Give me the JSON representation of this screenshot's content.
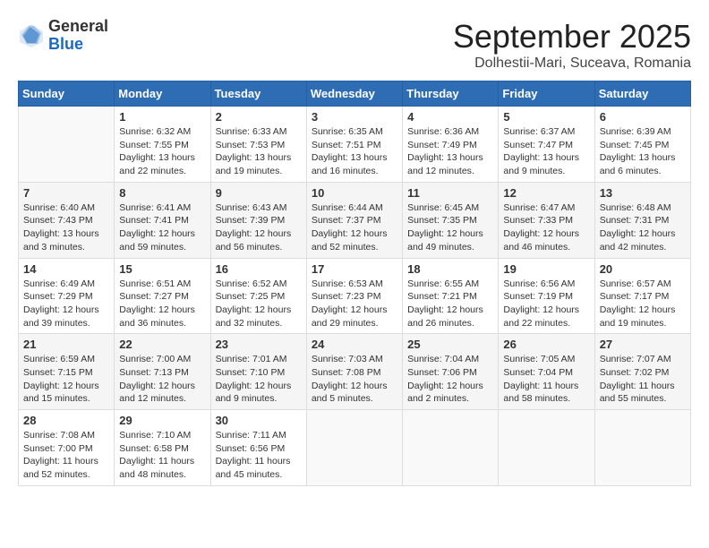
{
  "logo": {
    "general": "General",
    "blue": "Blue"
  },
  "title": "September 2025",
  "location": "Dolhestii-Mari, Suceava, Romania",
  "headers": [
    "Sunday",
    "Monday",
    "Tuesday",
    "Wednesday",
    "Thursday",
    "Friday",
    "Saturday"
  ],
  "weeks": [
    [
      {
        "day": "",
        "content": ""
      },
      {
        "day": "1",
        "content": "Sunrise: 6:32 AM\nSunset: 7:55 PM\nDaylight: 13 hours and 22 minutes."
      },
      {
        "day": "2",
        "content": "Sunrise: 6:33 AM\nSunset: 7:53 PM\nDaylight: 13 hours and 19 minutes."
      },
      {
        "day": "3",
        "content": "Sunrise: 6:35 AM\nSunset: 7:51 PM\nDaylight: 13 hours and 16 minutes."
      },
      {
        "day": "4",
        "content": "Sunrise: 6:36 AM\nSunset: 7:49 PM\nDaylight: 13 hours and 12 minutes."
      },
      {
        "day": "5",
        "content": "Sunrise: 6:37 AM\nSunset: 7:47 PM\nDaylight: 13 hours and 9 minutes."
      },
      {
        "day": "6",
        "content": "Sunrise: 6:39 AM\nSunset: 7:45 PM\nDaylight: 13 hours and 6 minutes."
      }
    ],
    [
      {
        "day": "7",
        "content": "Sunrise: 6:40 AM\nSunset: 7:43 PM\nDaylight: 13 hours and 3 minutes."
      },
      {
        "day": "8",
        "content": "Sunrise: 6:41 AM\nSunset: 7:41 PM\nDaylight: 12 hours and 59 minutes."
      },
      {
        "day": "9",
        "content": "Sunrise: 6:43 AM\nSunset: 7:39 PM\nDaylight: 12 hours and 56 minutes."
      },
      {
        "day": "10",
        "content": "Sunrise: 6:44 AM\nSunset: 7:37 PM\nDaylight: 12 hours and 52 minutes."
      },
      {
        "day": "11",
        "content": "Sunrise: 6:45 AM\nSunset: 7:35 PM\nDaylight: 12 hours and 49 minutes."
      },
      {
        "day": "12",
        "content": "Sunrise: 6:47 AM\nSunset: 7:33 PM\nDaylight: 12 hours and 46 minutes."
      },
      {
        "day": "13",
        "content": "Sunrise: 6:48 AM\nSunset: 7:31 PM\nDaylight: 12 hours and 42 minutes."
      }
    ],
    [
      {
        "day": "14",
        "content": "Sunrise: 6:49 AM\nSunset: 7:29 PM\nDaylight: 12 hours and 39 minutes."
      },
      {
        "day": "15",
        "content": "Sunrise: 6:51 AM\nSunset: 7:27 PM\nDaylight: 12 hours and 36 minutes."
      },
      {
        "day": "16",
        "content": "Sunrise: 6:52 AM\nSunset: 7:25 PM\nDaylight: 12 hours and 32 minutes."
      },
      {
        "day": "17",
        "content": "Sunrise: 6:53 AM\nSunset: 7:23 PM\nDaylight: 12 hours and 29 minutes."
      },
      {
        "day": "18",
        "content": "Sunrise: 6:55 AM\nSunset: 7:21 PM\nDaylight: 12 hours and 26 minutes."
      },
      {
        "day": "19",
        "content": "Sunrise: 6:56 AM\nSunset: 7:19 PM\nDaylight: 12 hours and 22 minutes."
      },
      {
        "day": "20",
        "content": "Sunrise: 6:57 AM\nSunset: 7:17 PM\nDaylight: 12 hours and 19 minutes."
      }
    ],
    [
      {
        "day": "21",
        "content": "Sunrise: 6:59 AM\nSunset: 7:15 PM\nDaylight: 12 hours and 15 minutes."
      },
      {
        "day": "22",
        "content": "Sunrise: 7:00 AM\nSunset: 7:13 PM\nDaylight: 12 hours and 12 minutes."
      },
      {
        "day": "23",
        "content": "Sunrise: 7:01 AM\nSunset: 7:10 PM\nDaylight: 12 hours and 9 minutes."
      },
      {
        "day": "24",
        "content": "Sunrise: 7:03 AM\nSunset: 7:08 PM\nDaylight: 12 hours and 5 minutes."
      },
      {
        "day": "25",
        "content": "Sunrise: 7:04 AM\nSunset: 7:06 PM\nDaylight: 12 hours and 2 minutes."
      },
      {
        "day": "26",
        "content": "Sunrise: 7:05 AM\nSunset: 7:04 PM\nDaylight: 11 hours and 58 minutes."
      },
      {
        "day": "27",
        "content": "Sunrise: 7:07 AM\nSunset: 7:02 PM\nDaylight: 11 hours and 55 minutes."
      }
    ],
    [
      {
        "day": "28",
        "content": "Sunrise: 7:08 AM\nSunset: 7:00 PM\nDaylight: 11 hours and 52 minutes."
      },
      {
        "day": "29",
        "content": "Sunrise: 7:10 AM\nSunset: 6:58 PM\nDaylight: 11 hours and 48 minutes."
      },
      {
        "day": "30",
        "content": "Sunrise: 7:11 AM\nSunset: 6:56 PM\nDaylight: 11 hours and 45 minutes."
      },
      {
        "day": "",
        "content": ""
      },
      {
        "day": "",
        "content": ""
      },
      {
        "day": "",
        "content": ""
      },
      {
        "day": "",
        "content": ""
      }
    ]
  ]
}
